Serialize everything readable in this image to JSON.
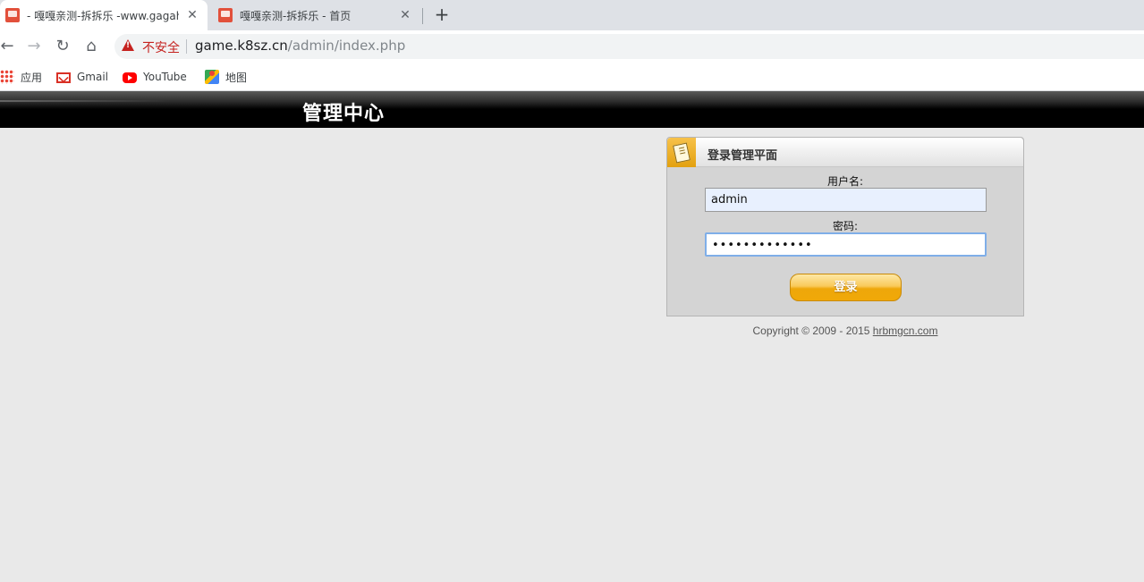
{
  "browser": {
    "tabs": [
      {
        "title": "- 嘎嘎亲测-拆拆乐 -www.gagah",
        "active": true
      },
      {
        "title": "嘎嘎亲测-拆拆乐 - 首页",
        "active": false
      }
    ],
    "tab_close_glyph": "✕",
    "new_tab_glyph": "+",
    "nav": {
      "back": "←",
      "forward": "→",
      "reload": "↻",
      "home": "⌂"
    },
    "security_label": "不安全",
    "url_host": "game.k8sz.cn",
    "url_path": "/admin/index.php",
    "bookmarks": [
      {
        "label": "应用",
        "icon": "apps-grid-icon"
      },
      {
        "label": "Gmail",
        "icon": "gmail-icon"
      },
      {
        "label": "YouTube",
        "icon": "youtube-icon"
      },
      {
        "label": "地图",
        "icon": "maps-icon"
      }
    ]
  },
  "page": {
    "header_title": "管理中心",
    "login": {
      "panel_title": "登录管理平面",
      "username_label": "用户名:",
      "username_value": "admin",
      "password_label": "密码:",
      "password_value": "•••••••••••••",
      "submit_label": "登录"
    },
    "copyright_text": "Copyright © 2009 - 2015 ",
    "copyright_link": "hrbmgcn.com"
  },
  "colors": {
    "page_bg": "#e9e9e9",
    "header_bg": "#000000",
    "panel_bg": "#d4d4d4",
    "button_accent": "#eea70a",
    "insecure_red": "#c5221f"
  }
}
